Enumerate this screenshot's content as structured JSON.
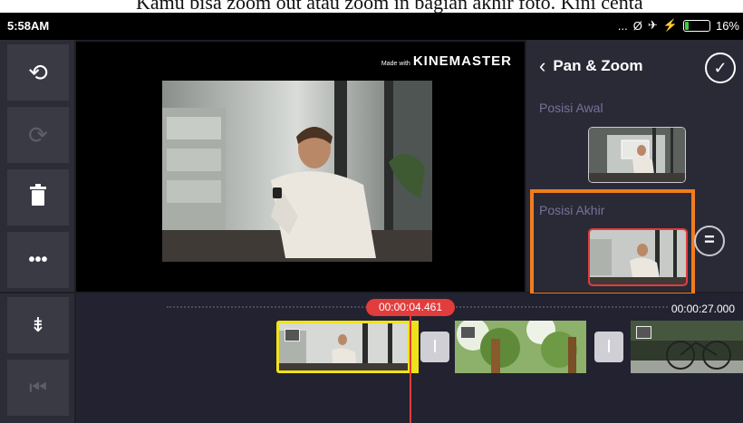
{
  "caption": {
    "text": "Kamu bisa zoom out atau zoom in bagian akhir foto. Kini centa"
  },
  "status_bar": {
    "time": "5:58AM",
    "more": "...",
    "mute_icon": "Ø",
    "airplane_icon": "✈",
    "charging_icon": "⚡",
    "battery_percent": "16%",
    "battery_level": 0.16
  },
  "toolbar": {
    "undo_icon": "⟲",
    "redo_icon": "⟳",
    "delete_icon": "🗑",
    "more_icon": "•••"
  },
  "preview": {
    "watermark_prefix": "Made with",
    "watermark_brand": "KINEMASTER"
  },
  "panel": {
    "back_icon": "‹",
    "title": "Pan & Zoom",
    "confirm_icon": "✓",
    "start_label": "Posisi Awal",
    "end_label": "Posisi Akhir",
    "swap_icon": "="
  },
  "timeline": {
    "current_time": "00:00:04.461",
    "total_time": "00:00:27.000",
    "split_icon": "⇟",
    "skip_start_icon": "⏮",
    "transition_icon": "I"
  },
  "colors": {
    "accent": "#e23c3c",
    "highlight": "#f07d1e",
    "selection": "#f0e21a",
    "battery": "#37d03b"
  }
}
